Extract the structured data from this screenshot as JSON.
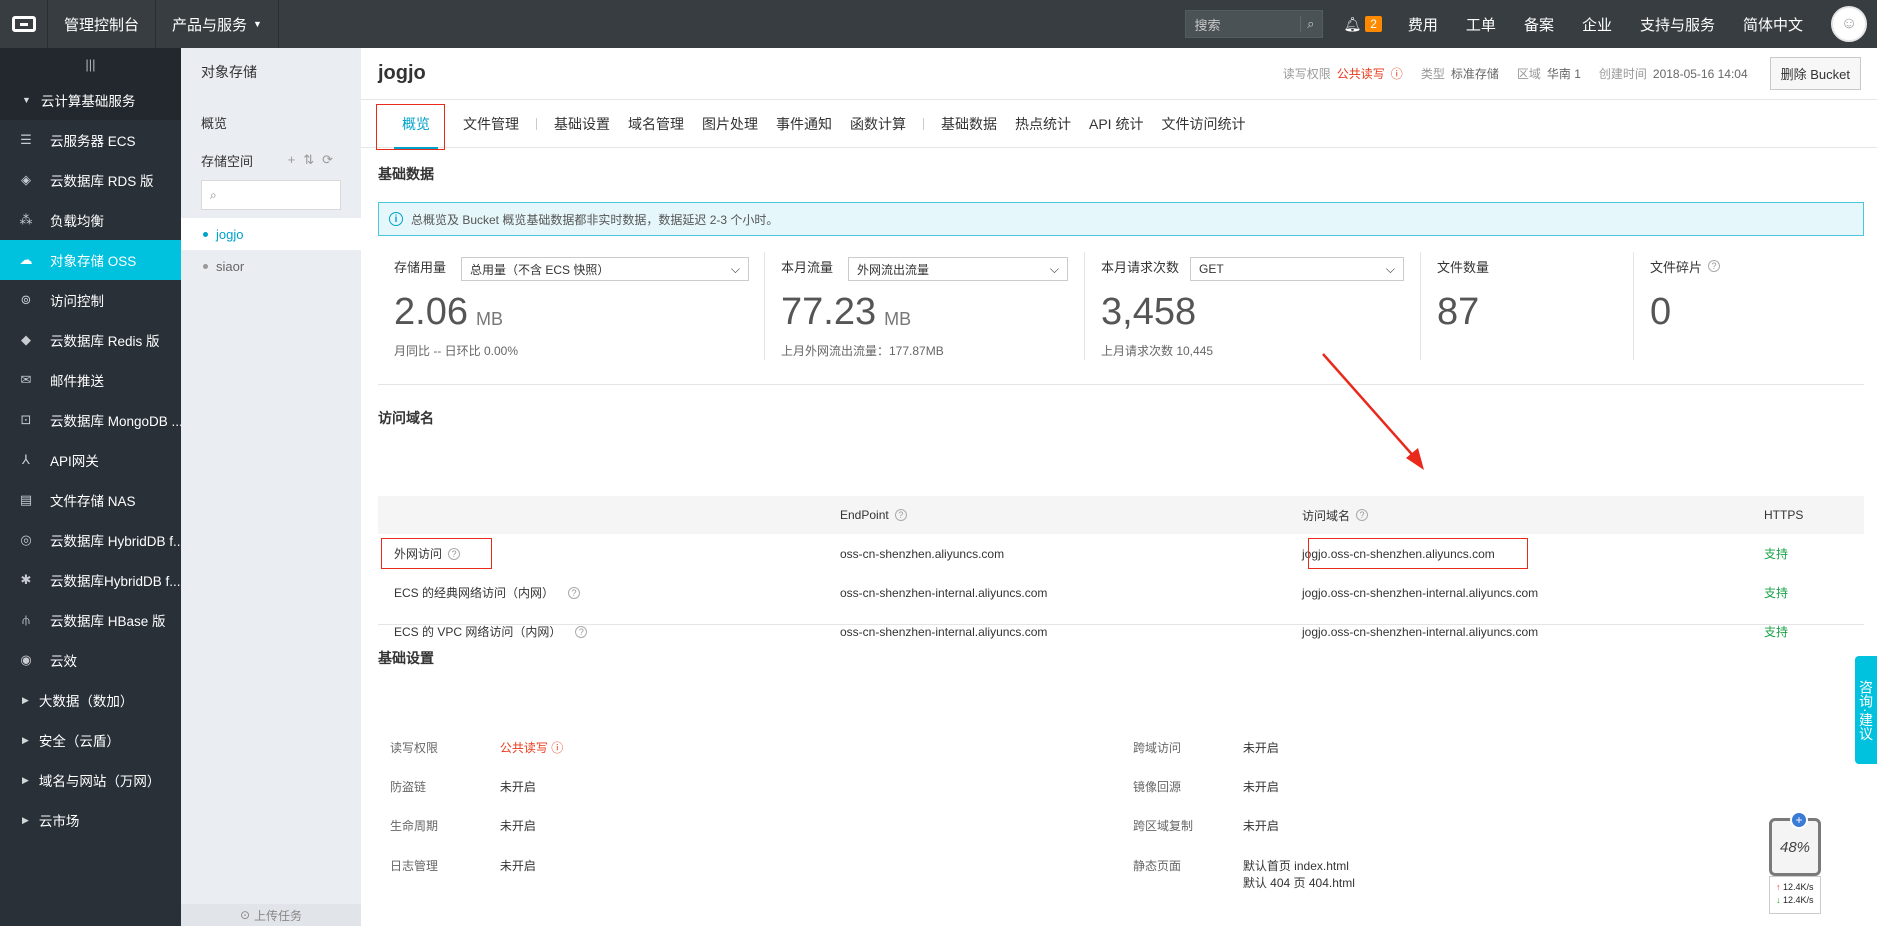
{
  "topbar": {
    "console": "管理控制台",
    "products": "产品与服务",
    "search_placeholder": "搜索",
    "notif_count": "2",
    "links": [
      "费用",
      "工单",
      "备案",
      "企业",
      "支持与服务",
      "简体中文"
    ]
  },
  "sidebar": {
    "group1": "云计算基础服务",
    "items": [
      "云服务器 ECS",
      "云数据库 RDS 版",
      "负载均衡",
      "对象存储 OSS",
      "访问控制",
      "云数据库 Redis 版",
      "邮件推送",
      "云数据库 MongoDB ...",
      "API网关",
      "文件存储 NAS",
      "云数据库 HybridDB f...",
      "云数据库HybridDB f...",
      "云数据库 HBase 版",
      "云效"
    ],
    "groups": [
      "大数据（数加）",
      "安全（云盾）",
      "域名与网站（万网）",
      "云市场"
    ]
  },
  "subnav": {
    "title": "对象存储",
    "overview": "概览",
    "storage": "存储空间",
    "buckets": [
      "jogjo",
      "siaor"
    ],
    "upload": "上传任务"
  },
  "bucket": {
    "name": "jogjo",
    "rw_label": "读写权限",
    "rw_value": "公共读写",
    "type_label": "类型",
    "type_value": "标准存储",
    "region_label": "区域",
    "region_value": "华南 1",
    "created_label": "创建时间",
    "created_value": "2018-05-16 14:04",
    "delete_btn": "删除 Bucket"
  },
  "tabs": {
    "group1": [
      "概览",
      "文件管理"
    ],
    "group2": [
      "基础设置",
      "域名管理",
      "图片处理",
      "事件通知",
      "函数计算"
    ],
    "group3": [
      "基础数据",
      "热点统计",
      "API 统计",
      "文件访问统计"
    ]
  },
  "basic": {
    "title": "基础数据",
    "notice": "总概览及 Bucket 概览基础数据都非实时数据，数据延迟 2-3 个小时。"
  },
  "stats": [
    {
      "label": "存储用量",
      "select": "总用量（不含 ECS 快照）",
      "value": "2.06",
      "unit": "MB",
      "sub": "月同比  --   日环比  0.00%"
    },
    {
      "label": "本月流量",
      "select": "外网流出流量",
      "value": "77.23",
      "unit": "MB",
      "sub": "上月外网流出流量：177.87MB"
    },
    {
      "label": "本月请求次数",
      "select": "GET",
      "value": "3,458",
      "unit": "",
      "sub": "上月请求次数  10,445"
    },
    {
      "label": "文件数量",
      "select": "",
      "value": "87",
      "unit": "",
      "sub": ""
    },
    {
      "label": "文件碎片",
      "select": "",
      "value": "0",
      "unit": "",
      "sub": ""
    }
  ],
  "domains": {
    "title": "访问域名",
    "headers": [
      "",
      "EndPoint",
      "访问域名",
      "HTTPS"
    ],
    "rows": [
      {
        "name": "外网访问",
        "endpoint": "oss-cn-shenzhen.aliyuncs.com",
        "domain": "jogjo.oss-cn-shenzhen.aliyuncs.com",
        "https": "支持"
      },
      {
        "name": "ECS 的经典网络访问（内网）",
        "endpoint": "oss-cn-shenzhen-internal.aliyuncs.com",
        "domain": "jogjo.oss-cn-shenzhen-internal.aliyuncs.com",
        "https": "支持"
      },
      {
        "name": "ECS 的 VPC 网络访问（内网）",
        "endpoint": "oss-cn-shenzhen-internal.aliyuncs.com",
        "domain": "jogjo.oss-cn-shenzhen-internal.aliyuncs.com",
        "https": "支持"
      }
    ]
  },
  "settings": {
    "title": "基础设置",
    "rows": [
      {
        "k1": "读写权限",
        "v1": "公共读写",
        "k2": "跨域访问",
        "v2": "未开启"
      },
      {
        "k1": "防盗链",
        "v1": "未开启",
        "k2": "镜像回源",
        "v2": "未开启"
      },
      {
        "k1": "生命周期",
        "v1": "未开启",
        "k2": "跨区域复制",
        "v2": "未开启"
      },
      {
        "k1": "日志管理",
        "v1": "未开启",
        "k2": "静态页面",
        "v2": "默认首页 index.html",
        "v2b": "默认 404 页 404.html"
      }
    ]
  },
  "consult": "咨询·建议",
  "widget": {
    "percent": "48%",
    "up": "12.4K/s",
    "down": "12.4K/s"
  },
  "colors": {
    "accent": "#00c1de",
    "link": "#00a2ca",
    "danger": "#e8391b",
    "success": "#1aa24a"
  }
}
